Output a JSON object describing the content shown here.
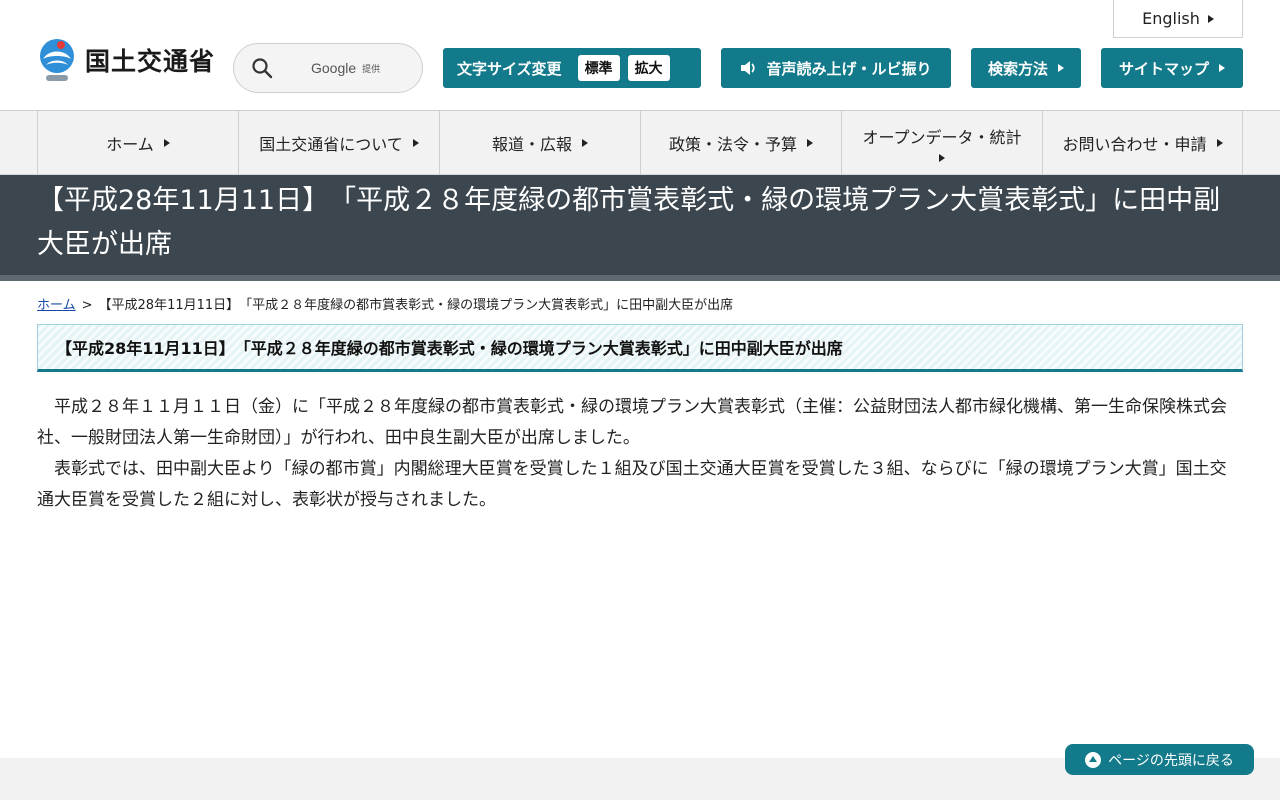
{
  "header": {
    "english_label": "English",
    "logo_text": "国土交通省",
    "search": {
      "brand": "Google",
      "brand_suffix": "提供"
    },
    "font_size": {
      "label": "文字サイズ変更",
      "standard": "標準",
      "large": "拡大"
    },
    "voice_label": "音声読み上げ・ルビ振り",
    "search_method_label": "検索方法",
    "sitemap_label": "サイトマップ"
  },
  "gnav": {
    "items": [
      "ホーム",
      "国土交通省について",
      "報道・広報",
      "政策・法令・予算",
      "オープンデータ・統計",
      "お問い合わせ・申請"
    ]
  },
  "page": {
    "title": "【平成28年11月11日】　「平成２８年度緑の都市賞表彰式・緑の環境プラン大賞表彰式」に田中副大臣が出席",
    "breadcrumb": {
      "home": "ホーム",
      "separator": ">",
      "current": "【平成28年11月11日】　「平成２８年度緑の都市賞表彰式・緑の環境プラン大賞表彰式」に田中副大臣が出席"
    },
    "heading": "【平成28年11月11日】　「平成２８年度緑の都市賞表彰式・緑の環境プラン大賞表彰式」に田中副大臣が出席",
    "paragraphs": [
      "平成２８年１１月１１日（金）に「平成２８年度緑の都市賞表彰式・緑の環境プラン大賞表彰式（主催：公益財団法人都市緑化機構、第一生命保険株式会社、一般財団法人第一生命財団）」が行われ、田中良生副大臣が出席しました。",
      "表彰式では、田中副大臣より「緑の都市賞」内閣総理大臣賞を受賞した１組及び国土交通大臣賞を受賞した３組、ならびに「緑の環境プラン大賞」国土交通大臣賞を受賞した２組に対し、表彰状が授与されました。"
    ]
  },
  "pagetop_label": "ページの先頭に戻る",
  "colors": {
    "accent": "#127a8a",
    "title_band": "#3b464e"
  }
}
